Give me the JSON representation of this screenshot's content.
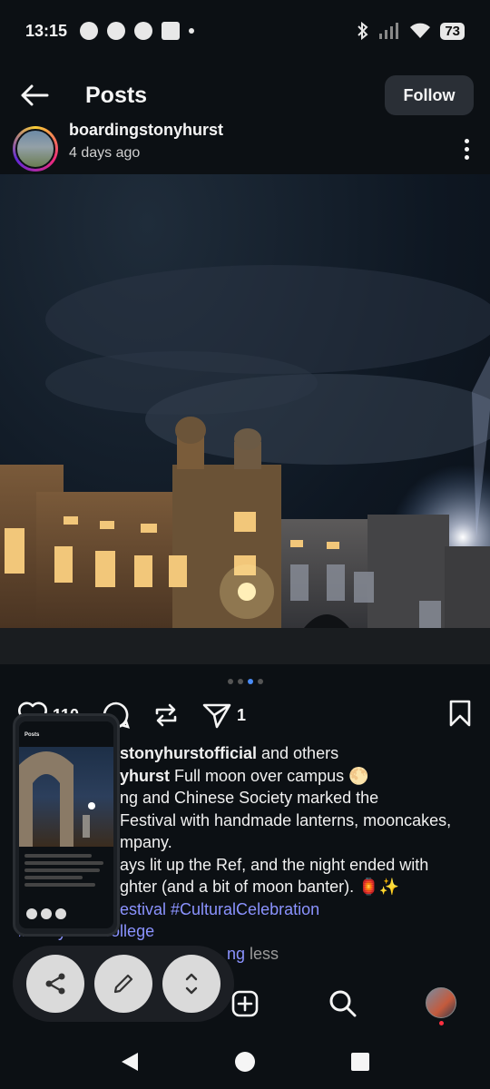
{
  "status_bar": {
    "time": "13:15",
    "battery": "73"
  },
  "header": {
    "title": "Posts",
    "follow_label": "Follow"
  },
  "post": {
    "username": "boardingstonyhurst",
    "time_ago": "4 days ago",
    "likes": "110",
    "shares": "1",
    "liked_by_prefix": "stonyhurstofficial",
    "liked_by_suffix": " and others",
    "caption_user": "yhurst",
    "caption_line1": " Full moon over campus 🌕",
    "caption_line2": "ng and Chinese Society marked the",
    "caption_line3": "Festival with handmade lanterns, mooncakes,",
    "caption_line4": "mpany.",
    "caption_line5": "ays lit up the Ref, and the night ended with",
    "caption_line6": "ghter (and a bit of moon banter). 🏮✨",
    "hashtag_line7": "estival #CulturalCelebration",
    "hashtag_line8": "#stonyhurstcollege",
    "hashtag_line9": "ng",
    "less_label": " less"
  },
  "carousel": {
    "count": 4,
    "active": 2
  },
  "icons": {
    "back": "arrow-left-icon",
    "more": "more-vertical-icon",
    "like": "heart-icon",
    "comment": "comment-icon",
    "repost": "repost-icon",
    "share": "send-icon",
    "bookmark": "bookmark-icon",
    "float_share": "share-icon",
    "float_edit": "pencil-icon",
    "float_expand": "expand-icon",
    "nav_create": "plus-square-icon",
    "nav_search": "search-icon",
    "nav_profile": "avatar"
  },
  "colors": {
    "background": "#0c1014",
    "hashtag": "#8b93ff",
    "carousel_active": "#4a8cf7",
    "follow_bg": "#2a2f36"
  }
}
